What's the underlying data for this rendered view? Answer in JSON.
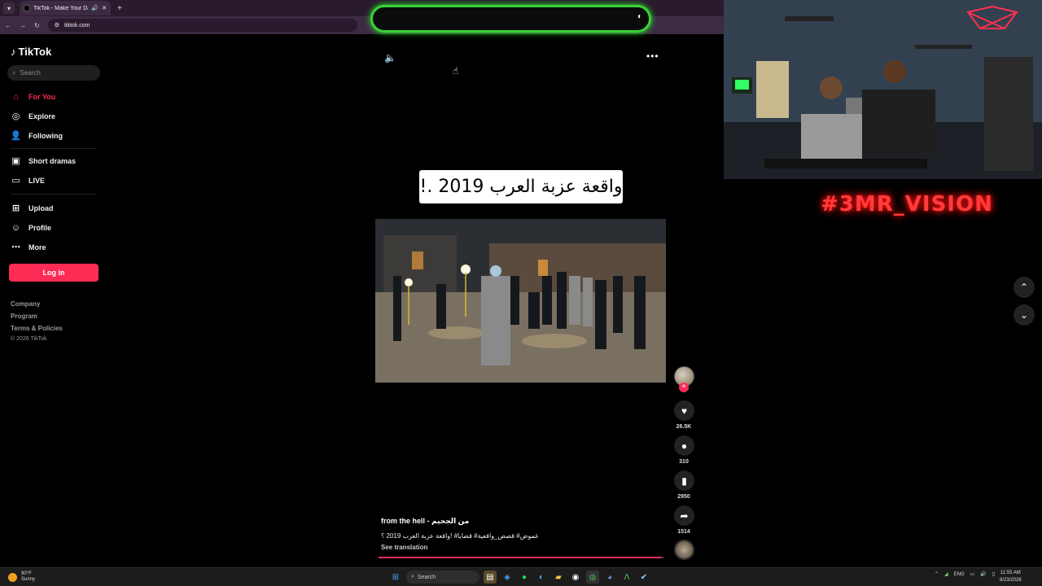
{
  "browser": {
    "tab_title": "TikTok - Make Your Day",
    "new_tab": "+",
    "url": "tiktok.com"
  },
  "sidebar": {
    "logo_text": "TikTok",
    "search_placeholder": "Search",
    "items": [
      {
        "label": "For You",
        "icon": "home-icon"
      },
      {
        "label": "Explore",
        "icon": "compass-icon"
      },
      {
        "label": "Following",
        "icon": "users-icon"
      },
      {
        "label": "Short dramas",
        "icon": "film-icon"
      },
      {
        "label": "LIVE",
        "icon": "tv-icon"
      },
      {
        "label": "Upload",
        "icon": "plus-square-icon"
      },
      {
        "label": "Profile",
        "icon": "user-icon"
      },
      {
        "label": "More",
        "icon": "ellipsis-icon"
      }
    ],
    "login_label": "Log in",
    "footer": [
      "Company",
      "Program",
      "Terms & Policies",
      "© 2026 TikTok"
    ]
  },
  "video": {
    "title_card": "واقعة عزبة العرب 2019 .!",
    "author": "from the hell - من الجحيم",
    "caption": "غموض# قصص_واقعية# قضايا# !واقعة عزبة العرب 2019 ؟",
    "see_translation": "See translation",
    "progress": 0.99
  },
  "actions": {
    "likes": "26.5K",
    "comments": "310",
    "saves": "2950",
    "shares": "1514"
  },
  "stream": {
    "brand": "#3MR_VISION"
  },
  "taskbar": {
    "temp": "90°F",
    "weather": "Sunny",
    "search_label": "Search",
    "lang": "ENG",
    "time": "11:55 AM",
    "date": "8/23/2026"
  },
  "colors": {
    "accent": "#fe2c55",
    "brand_glow": "#ff3b3b",
    "banner_border": "#3ad13a"
  }
}
